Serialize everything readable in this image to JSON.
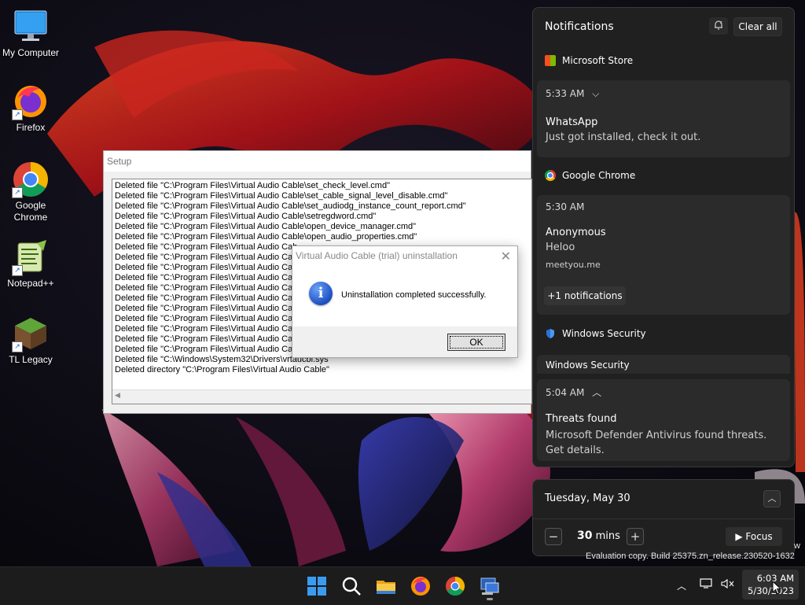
{
  "desktop": {
    "icons": [
      {
        "label": "My Computer",
        "icon": "monitor-icon"
      },
      {
        "label": "Firefox",
        "icon": "firefox-icon"
      },
      {
        "label": "Google\nChrome",
        "icon": "chrome-icon"
      },
      {
        "label": "Notepad++",
        "icon": "notepadpp-icon"
      },
      {
        "label": "TL Legacy",
        "icon": "minecraft-icon"
      }
    ]
  },
  "setup_window": {
    "title": "Setup",
    "log_lines": [
      "Deleted file \"C:\\Program Files\\Virtual Audio Cable\\set_check_level.cmd\"",
      "Deleted file \"C:\\Program Files\\Virtual Audio Cable\\set_cable_signal_level_disable.cmd\"",
      "Deleted file \"C:\\Program Files\\Virtual Audio Cable\\set_audiodg_instance_count_report.cmd\"",
      "Deleted file \"C:\\Program Files\\Virtual Audio Cable\\setregdword.cmd\"",
      "Deleted file \"C:\\Program Files\\Virtual Audio Cable\\open_device_manager.cmd\"",
      "Deleted file \"C:\\Program Files\\Virtual Audio Cable\\open_audio_properties.cmd\"",
      "Deleted file \"C:\\Program Files\\Virtual Audio Cab",
      "Deleted file \"C:\\Program Files\\Virtual Audio Cab",
      "Deleted file \"C:\\Program Files\\Virtual Audio Cab",
      "Deleted file \"C:\\Program Files\\Virtual Audio Cab",
      "Deleted file \"C:\\Program Files\\Virtual Audio Cab",
      "Deleted file \"C:\\Program Files\\Virtual Audio Cab",
      "Deleted file \"C:\\Program Files\\Virtual Audio Cab",
      "Deleted file \"C:\\Program Files\\Virtual Audio Cab",
      "Deleted file \"C:\\Program Files\\Virtual Audio Cab",
      "Deleted file \"C:\\Program Files\\Virtual Audio Cab",
      "Deleted file \"C:\\Program Files\\Virtual Audio Cab",
      "Deleted file \"C:\\Windows\\System32\\Drivers\\vrtaucbl.sys\"",
      "Deleted directory \"C:\\Program Files\\Virtual Audio Cable\""
    ]
  },
  "dialog": {
    "title": "Virtual Audio Cable (trial) uninstallation",
    "close_glyph": "✕",
    "message": "Uninstallation completed successfully.",
    "ok_label": "OK",
    "icon": "info-icon"
  },
  "notifications": {
    "header_title": "Notifications",
    "clear_all_label": "Clear all",
    "groups": {
      "store": {
        "app": "Microsoft Store",
        "time": "5:33 AM",
        "title": "WhatsApp",
        "body": "Just got installed, check it out."
      },
      "chrome": {
        "app": "Google Chrome",
        "time": "5:30 AM",
        "title": "Anonymous",
        "body": "Heloo",
        "source": "meetyou.me",
        "more": "+1 notifications"
      },
      "security": {
        "app": "Windows Security",
        "card_heading": "Windows Security",
        "time": "5:04 AM",
        "title": "Threats found",
        "body": "Microsoft Defender Antivirus found threats. Get details."
      }
    }
  },
  "calendar": {
    "date": "Tuesday, May 30",
    "focus_minutes": "30",
    "focus_unit": "mins",
    "focus_label": "Focus"
  },
  "watermark": {
    "build": "Evaluation copy. Build 25375.zn_release.230520-1632",
    "partial": "w"
  },
  "taskbar": {
    "pinned": [
      "windows-start-icon",
      "search-icon",
      "file-explorer-icon",
      "firefox-icon",
      "chrome-icon",
      "setup-app-icon"
    ],
    "clock_time": "6:03 AM",
    "clock_date": "5/30/2023"
  },
  "colors": {
    "panel_bg": "#202020",
    "card_bg": "#2b2b2b",
    "taskbar_bg": "#1c1c1c",
    "security_blue": "#2a72d8"
  }
}
